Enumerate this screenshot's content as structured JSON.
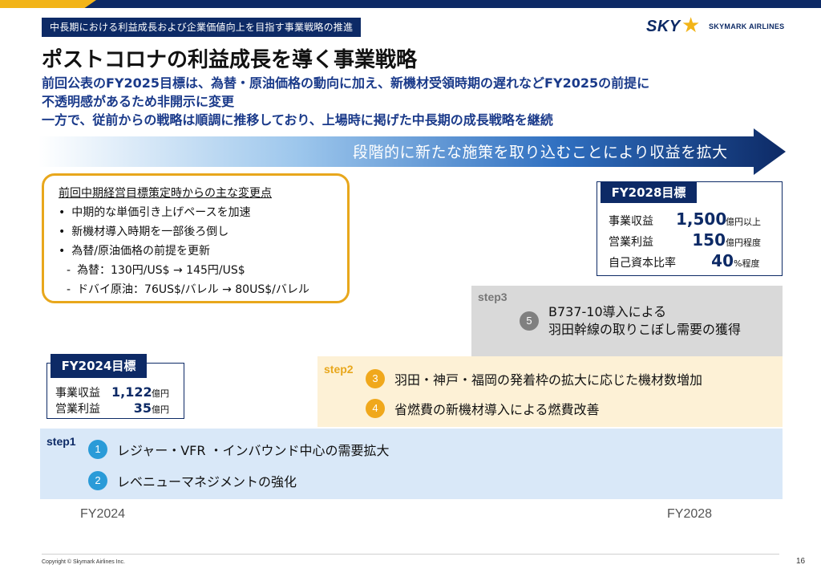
{
  "header": {
    "section_tag": "中長期における利益成長および企業価値向上を目指す事業戦略の推進",
    "logo_mark": "SKY",
    "logo_text": "SKYMARK AIRLINES"
  },
  "title": "ポストコロナの利益成長を導く事業戦略",
  "lead": [
    "前回公表のFY2025目標は、為替・原油価格の動向に加え、新機材受領時期の遅れなどFY2025の前提に",
    "不透明感があるため非開示に変更",
    "一方で、従前からの戦略は順調に推移しており、上場時に掲げた中長期の成長戦略を継続"
  ],
  "arrow_text": "段階的に新たな施策を取り込むことにより収益を拡大",
  "changes": {
    "title": "前回中期経営目標策定時からの主な変更点",
    "bullets": [
      "中期的な単価引き上げペースを加速",
      "新機材導入時期を一部後ろ倒し",
      "為替/原油価格の前提を更新"
    ],
    "subs": [
      "為替：130円/US$ → 145円/US$",
      "ドバイ原油：76US$/バレル → 80US$/バレル"
    ]
  },
  "fy2028": {
    "title": "FY2028目標",
    "rows": [
      {
        "label": "事業収益",
        "value": "1,500",
        "unit": "億円以上"
      },
      {
        "label": "営業利益",
        "value": "150",
        "unit": "億円程度"
      },
      {
        "label": "自己資本比率",
        "value": "40",
        "unit": "%程度"
      }
    ]
  },
  "fy2024": {
    "title": "FY2024目標",
    "rows": [
      {
        "label": "事業収益",
        "value": "1,122",
        "unit": "億円"
      },
      {
        "label": "営業利益",
        "value": "35",
        "unit": "億円"
      }
    ]
  },
  "steps": {
    "step3": {
      "label": "step3",
      "items": [
        {
          "num": "5",
          "text_line1": "B737-10導入による",
          "text_line2": "羽田幹線の取りこぼし需要の獲得"
        }
      ]
    },
    "step2": {
      "label": "step2",
      "items": [
        {
          "num": "3",
          "text": "羽田・神戸・福岡の発着枠の拡大に応じた機材数増加"
        },
        {
          "num": "4",
          "text": "省燃費の新機材導入による燃費改善"
        }
      ]
    },
    "step1": {
      "label": "step1",
      "items": [
        {
          "num": "1",
          "text": "レジャー・VFR ・インバウンド中心の需要拡大"
        },
        {
          "num": "2",
          "text": "レベニューマネジメントの強化"
        }
      ]
    }
  },
  "axis": {
    "start": "FY2024",
    "end": "FY2028"
  },
  "footer": {
    "copyright": "Copyright © Skymark Airlines Inc.",
    "page": "16"
  },
  "colors": {
    "navy": "#0d2a66",
    "gold": "#e8a71c",
    "step1_num": "#2a9bd8",
    "step2_num": "#f0a81c",
    "step3_num": "#808080"
  }
}
